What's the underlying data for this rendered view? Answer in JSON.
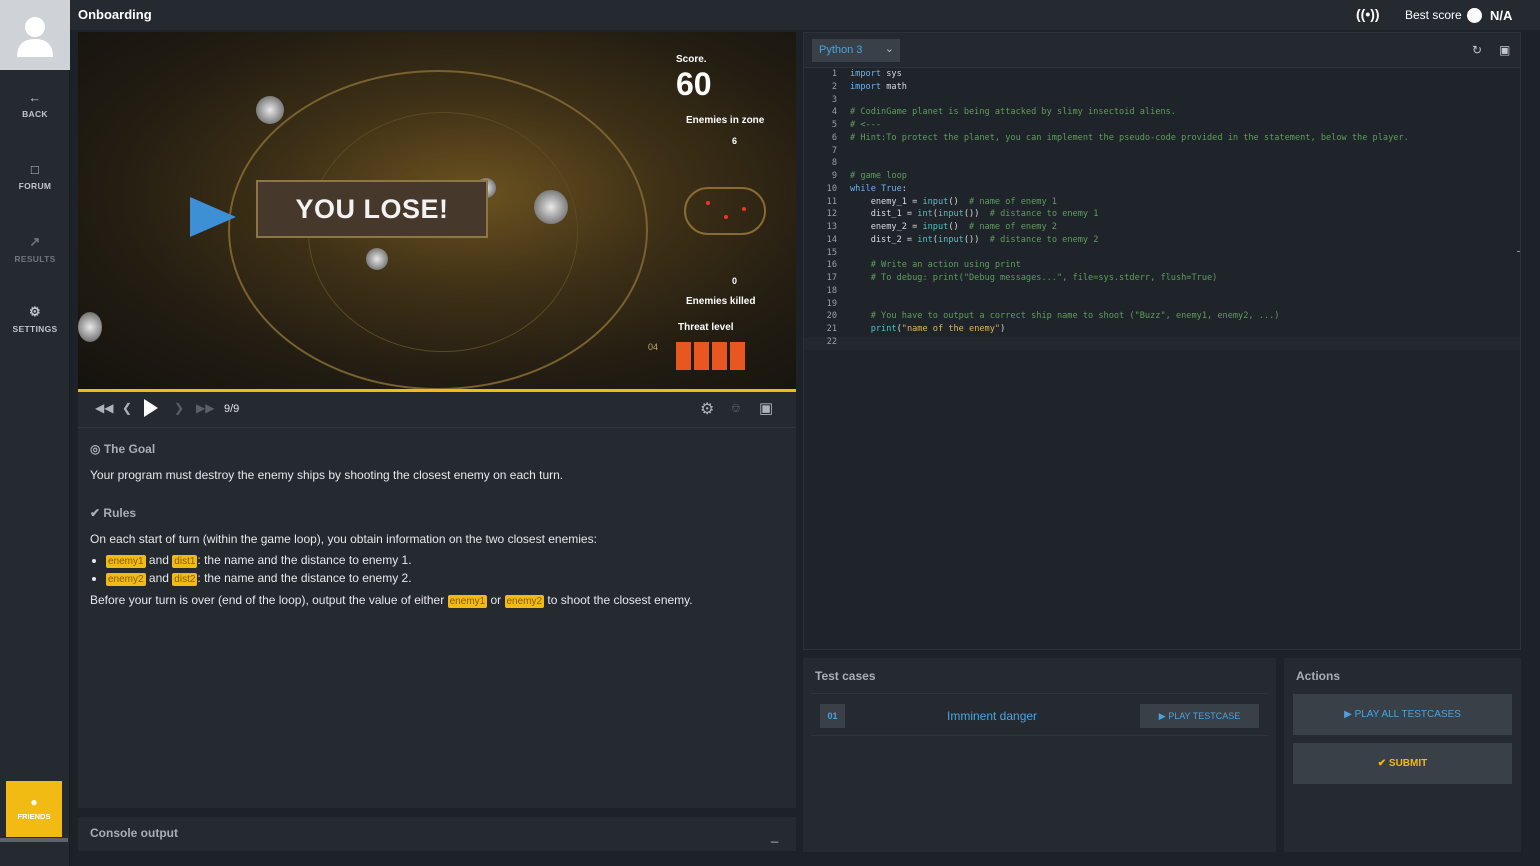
{
  "header": {
    "title": "Onboarding",
    "best_score_label": "Best score",
    "best_score_value": "N/A"
  },
  "sidebar": {
    "items": [
      {
        "label": "BACK",
        "icon": "arrow-left-icon"
      },
      {
        "label": "FORUM",
        "icon": "forum-icon"
      },
      {
        "label": "RESULTS",
        "icon": "chart-icon"
      },
      {
        "label": "SETTINGS",
        "icon": "gear-icon"
      }
    ],
    "friends_label": "FRIENDS"
  },
  "game": {
    "score_label": "Score.",
    "score_value": "60",
    "result_text": "YOU LOSE!",
    "enemies_in_zone_label": "Enemies in zone",
    "enemies_in_zone_value": "6",
    "enemies_killed_label": "Enemies killed",
    "enemies_killed_value": "0",
    "threat_level_label": "Threat level",
    "threat_level_value": "04",
    "threat_bars": 4
  },
  "player": {
    "frame": "9/9"
  },
  "statement": {
    "goal_title": "The Goal",
    "goal_text": "Your program must destroy the enemy ships by shooting the closest enemy on each turn.",
    "rules_title": "Rules",
    "rules_intro": "On each start of turn (within the game loop), you obtain information on the two closest enemies:",
    "var_enemy1": "enemy1",
    "var_dist1": "dist1",
    "var_enemy2": "enemy2",
    "var_dist2": "dist2",
    "and": "and",
    "or": "or",
    "bullet1_text": ": the name and the distance to enemy 1.",
    "bullet2_text": ": the name and the distance to enemy 2.",
    "output_prefix": "Before your turn is over (end of the loop), output the value of either",
    "output_suffix": "to shoot the closest enemy."
  },
  "console": {
    "label": "Console output",
    "minimize": "_"
  },
  "editor": {
    "language": "Python 3",
    "lines": [
      "import sys",
      "import math",
      "",
      "# CodinGame planet is being attacked by slimy insectoid aliens.",
      "# <---",
      "# Hint:To protect the planet, you can implement the pseudo-code provided in the statement, below the player.",
      "",
      "",
      "# game loop",
      "while True:",
      "    enemy_1 = input()  # name of enemy 1",
      "    dist_1 = int(input())  # distance to enemy 1",
      "    enemy_2 = input()  # name of enemy 2",
      "    dist_2 = int(input())  # distance to enemy 2",
      "",
      "    # Write an action using print",
      "    # To debug: print(\"Debug messages...\", file=sys.stderr, flush=True)",
      "",
      "",
      "    # You have to output a correct ship name to shoot (\"Buzz\", enemy1, enemy2, ...)",
      "    print(\"name of the enemy\")",
      ""
    ]
  },
  "tests": {
    "label": "Test cases",
    "cases": [
      {
        "number": "01",
        "name": "Imminent danger",
        "play_label": "PLAY TESTCASE"
      }
    ]
  },
  "actions": {
    "label": "Actions",
    "play_all": "PLAY ALL TESTCASES",
    "submit": "SUBMIT"
  },
  "colors": {
    "accent": "#f2bb13",
    "link": "#4aa3df",
    "threat": "#e8571f"
  }
}
